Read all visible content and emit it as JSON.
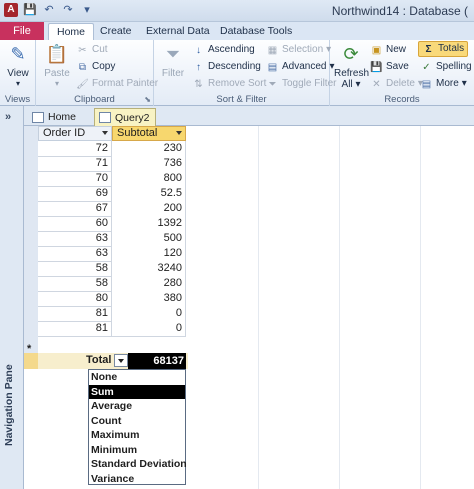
{
  "window": {
    "title": "Northwind14 : Database ("
  },
  "qat": {
    "save": "💾",
    "undo": "↶",
    "redo": "↷",
    "customize": "▾"
  },
  "ribbon_tabs": [
    "File",
    "Home",
    "Create",
    "External Data",
    "Database Tools"
  ],
  "ribbon": {
    "views": {
      "view_label": "View",
      "group": "Views"
    },
    "clipboard": {
      "paste": "Paste",
      "cut": "Cut",
      "copy": "Copy",
      "format_painter": "Format Painter",
      "group": "Clipboard"
    },
    "sort_filter": {
      "filter": "Filter",
      "ascending": "Ascending",
      "descending": "Descending",
      "remove_sort": "Remove Sort",
      "selection": "Selection",
      "advanced": "Advanced",
      "toggle_filter": "Toggle Filter",
      "group": "Sort & Filter"
    },
    "records": {
      "refresh": "Refresh",
      "refresh_all": "All",
      "new": "New",
      "save": "Save",
      "delete": "Delete",
      "totals": "Totals",
      "spelling": "Spelling",
      "more": "More",
      "group": "Records"
    }
  },
  "doc_tabs": [
    "Home",
    "Query2"
  ],
  "nav_pane": {
    "label": "Navigation Pane",
    "toggle": "»"
  },
  "datasheet": {
    "columns": [
      "Order ID",
      "Subtotal"
    ],
    "rows": [
      [
        "72",
        "230"
      ],
      [
        "71",
        "736"
      ],
      [
        "70",
        "800"
      ],
      [
        "69",
        "52.5"
      ],
      [
        "67",
        "200"
      ],
      [
        "60",
        "1392"
      ],
      [
        "63",
        "500"
      ],
      [
        "63",
        "120"
      ],
      [
        "58",
        "3240"
      ],
      [
        "58",
        "280"
      ],
      [
        "80",
        "380"
      ],
      [
        "81",
        "0"
      ],
      [
        "81",
        "0"
      ]
    ],
    "new_row_marker": "*",
    "total_label": "Total",
    "total_value": "68137"
  },
  "totals_dropdown": {
    "options": [
      "None",
      "Sum",
      "Average",
      "Count",
      "Maximum",
      "Minimum",
      "Standard Deviation",
      "Variance"
    ],
    "selected": "Sum"
  }
}
